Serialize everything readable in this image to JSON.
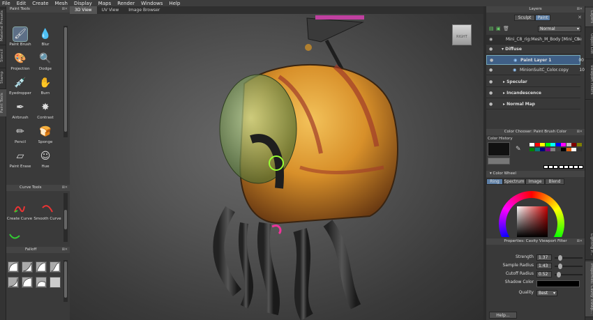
{
  "menu": [
    "File",
    "Edit",
    "Create",
    "Mesh",
    "Display",
    "Maps",
    "Render",
    "Windows",
    "Help"
  ],
  "left_vtabs": [
    "Material Presets",
    "Stencil",
    "Stamp",
    "Paint Tools"
  ],
  "paint_tools": {
    "title": "Paint Tools",
    "tools": [
      {
        "label": "Paint Brush",
        "icon": "paint-brush-icon",
        "glyph": "🖌"
      },
      {
        "label": "Blur",
        "icon": "blur-icon",
        "glyph": "💧"
      },
      {
        "label": "Projection",
        "icon": "projection-icon",
        "glyph": "🎨"
      },
      {
        "label": "Dodge",
        "icon": "dodge-icon",
        "glyph": "🔍"
      },
      {
        "label": "Eyedropper",
        "icon": "eyedropper-icon",
        "glyph": "💉"
      },
      {
        "label": "Burn",
        "icon": "burn-icon",
        "glyph": "✋"
      },
      {
        "label": "Airbrush",
        "icon": "airbrush-icon",
        "glyph": "✒"
      },
      {
        "label": "Contrast",
        "icon": "contrast-icon",
        "glyph": "✸"
      },
      {
        "label": "Pencil",
        "icon": "pencil-icon",
        "glyph": "✏"
      },
      {
        "label": "Sponge",
        "icon": "sponge-icon",
        "glyph": "🍞"
      },
      {
        "label": "Paint Erase",
        "icon": "eraser-icon",
        "glyph": "▱"
      },
      {
        "label": "Hue",
        "icon": "hue-icon",
        "glyph": "☺"
      }
    ]
  },
  "curve_tools": {
    "title": "Curve Tools",
    "tools": [
      {
        "label": "Create Curve",
        "icon": "create-curve-icon"
      },
      {
        "label": "Smooth Curve",
        "icon": "smooth-curve-icon"
      }
    ]
  },
  "falloff": {
    "title": "Falloff"
  },
  "viewport_tabs": [
    "3D View",
    "UV View",
    "Image Browser"
  ],
  "active_viewport_tab": "3D View",
  "layers": {
    "title": "Layers",
    "tabs": [
      "Sculpt",
      "Paint"
    ],
    "blend_mode": "Normal",
    "mesh_row": "Mini_C8_rig:Mesh_M_Body [Mini_C8",
    "mesh_row_suffix": "Se",
    "groups": [
      "Diffuse",
      "Specular",
      "Incandescence",
      "Normal Map"
    ],
    "layer_rows": [
      {
        "name": "Paint Layer 1",
        "value": "00"
      },
      {
        "name": "MinionSuitC_Color.copy",
        "value": "10"
      }
    ]
  },
  "color_panel": {
    "title": "Color Chooser: Paint Brush Color",
    "history_label": "Color History",
    "wheel_label": "Color Wheel",
    "wheel_tabs": [
      "Ring",
      "Spectrum",
      "Image",
      "Blend"
    ],
    "palette": [
      "#ffffff",
      "#ff0000",
      "#ffff00",
      "#00ff00",
      "#00ffff",
      "#0000ff",
      "#ff00ff",
      "#c0c0c0",
      "#800000",
      "#808000",
      "#008000",
      "#008080",
      "#000080",
      "#800080",
      "#808080",
      "#404040",
      "#000000",
      "#e06010",
      "#ffffff",
      "#333333"
    ]
  },
  "properties": {
    "title": "Properties: Cavity Viewport Filter",
    "rows": [
      {
        "label": "Strength",
        "value": "1.37",
        "level": 0.15
      },
      {
        "label": "Sample Radius",
        "value": "1.43",
        "level": 0.15
      },
      {
        "label": "Cutoff Radius",
        "value": "0.52",
        "level": 0.08
      }
    ],
    "shadow_label": "Shadow Color",
    "quality_label": "Quality",
    "quality_value": "Best",
    "help_label": "Help..."
  },
  "right_vtabs": [
    "Layers",
    "Object List",
    "Viewport Filters",
    "Lighting P...",
    "Properties: Cavity Viewp..."
  ],
  "colors": {
    "accent": "#5d7fa6",
    "panel": "#393939",
    "selected_row": "#3f5f86"
  }
}
